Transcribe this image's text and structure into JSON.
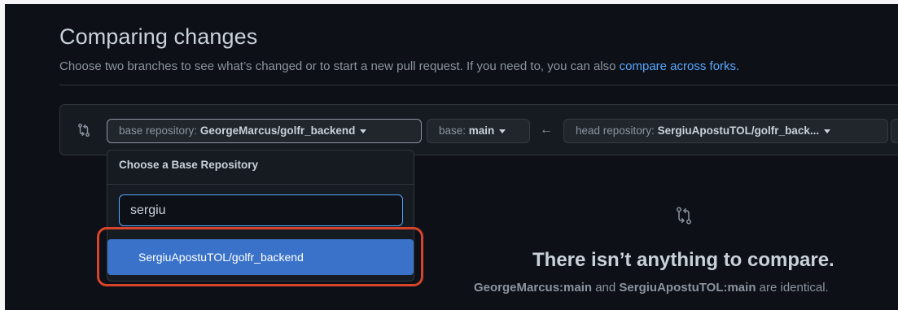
{
  "header": {
    "title": "Comparing changes",
    "subtitle_text": "Choose two branches to see what’s changed or to start a new pull request. If you need to, you can also ",
    "subtitle_link": "compare across forks."
  },
  "range": {
    "base_repo_prefix": "base repository: ",
    "base_repo_value": "GeorgeMarcus/golfr_backend",
    "base_branch_prefix": "base: ",
    "base_branch_value": "main",
    "arrow": "←",
    "head_repo_prefix": "head repository: ",
    "head_repo_value": "SergiuApostuTOL/golfr_back..."
  },
  "dropdown": {
    "header": "Choose a Base Repository",
    "filter_value": "sergiu",
    "results": [
      "SergiuApostuTOL/golfr_backend"
    ]
  },
  "empty_state": {
    "title": "There isn’t anything to compare.",
    "desc_base": "GeorgeMarcus:main",
    "desc_and": " and ",
    "desc_head": "SergiuApostuTOL:main",
    "desc_tail": " are identical."
  },
  "colors": {
    "background": "#0d1117",
    "accent": "#58a6ff",
    "selected_item": "#3a72c9",
    "annotation": "#d8432b"
  },
  "icons": [
    "compare-icon",
    "chevron-down-icon",
    "arrow-left-icon"
  ]
}
